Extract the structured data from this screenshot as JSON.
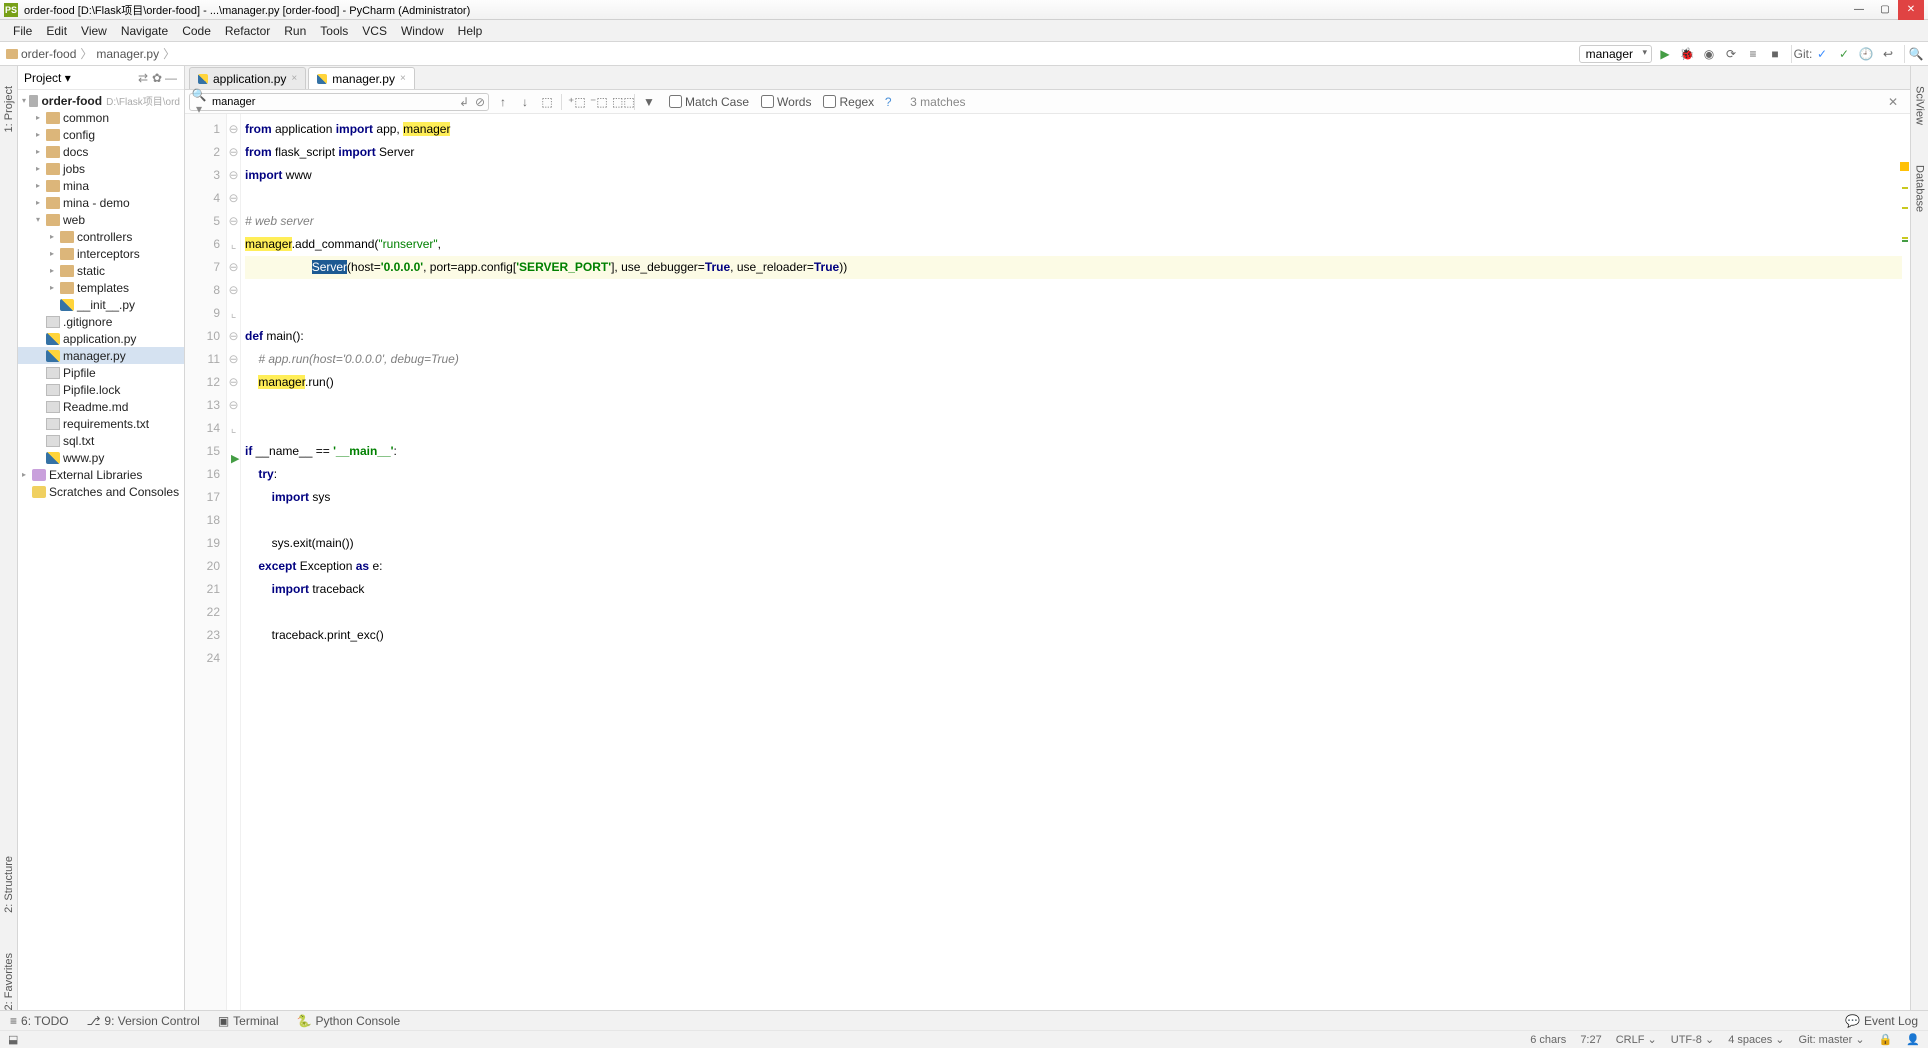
{
  "titleBar": {
    "text": "order-food [D:\\Flask项目\\order-food] - ...\\manager.py [order-food] - PyCharm (Administrator)",
    "appIconLetter": "PS"
  },
  "menuBar": [
    "File",
    "Edit",
    "View",
    "Navigate",
    "Code",
    "Refactor",
    "Run",
    "Tools",
    "VCS",
    "Window",
    "Help"
  ],
  "breadcrumb": [
    {
      "label": "order-food"
    },
    {
      "label": "manager.py"
    }
  ],
  "runConfig": "manager",
  "gitLabel": "Git:",
  "leftSidebarTabs": [
    "1: Project",
    "2: Structure",
    "2: Favorites"
  ],
  "rightSidebarTabs": [
    "SciView",
    "Database"
  ],
  "projectPanel": {
    "title": "Project",
    "root": {
      "label": "order-food",
      "path": "D:\\Flask项目\\ord"
    },
    "folders": [
      "common",
      "config",
      "docs",
      "jobs",
      "mina",
      "mina - demo"
    ],
    "webFolder": "web",
    "webChildren": [
      "controllers",
      "interceptors",
      "static",
      "templates"
    ],
    "webFiles": [
      {
        "label": "__init__.py",
        "icon": "py"
      }
    ],
    "rootFiles": [
      {
        "label": ".gitignore",
        "icon": "file"
      },
      {
        "label": "application.py",
        "icon": "py"
      },
      {
        "label": "manager.py",
        "icon": "py",
        "selected": true
      },
      {
        "label": "Pipfile",
        "icon": "file"
      },
      {
        "label": "Pipfile.lock",
        "icon": "file"
      },
      {
        "label": "Readme.md",
        "icon": "file"
      },
      {
        "label": "requirements.txt",
        "icon": "file"
      },
      {
        "label": "sql.txt",
        "icon": "file"
      },
      {
        "label": "www.py",
        "icon": "py"
      }
    ],
    "externalLibraries": "External Libraries",
    "scratches": "Scratches and Consoles"
  },
  "editorTabs": [
    {
      "label": "application.py",
      "active": false
    },
    {
      "label": "manager.py",
      "active": true
    }
  ],
  "findBar": {
    "query": "manager",
    "matchCase": "Match Case",
    "words": "Words",
    "regex": "Regex",
    "matches": "3 matches"
  },
  "code": {
    "lines": 24
  },
  "toolBottom": {
    "todo": "6: TODO",
    "vcs": "9: Version Control",
    "terminal": "Terminal",
    "pyConsole": "Python Console",
    "eventLog": "Event Log"
  },
  "statusBar": {
    "chars": "6 chars",
    "pos": "7:27",
    "lineEnd": "CRLF",
    "encoding": "UTF-8",
    "indent": "4 spaces",
    "branch": "Git: master"
  }
}
